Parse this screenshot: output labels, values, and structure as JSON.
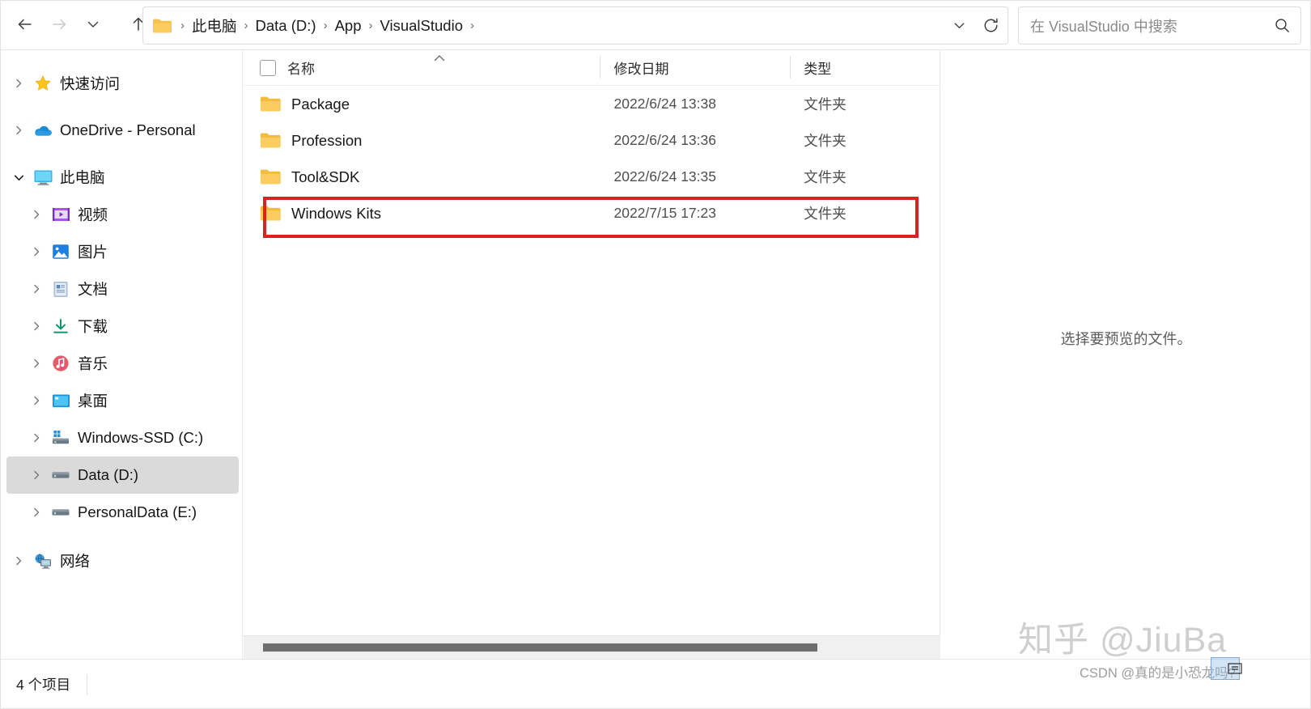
{
  "window": {
    "title": "VisualStudio"
  },
  "toolbar": {
    "back_label": "back-arrow",
    "forward_label": "forward-arrow",
    "recent_label": "recent-locations-chevron",
    "up_label": "up-arrow"
  },
  "address": {
    "folder_icon": "folder-icon",
    "crumbs": [
      "此电脑",
      "Data (D:)",
      "App",
      "VisualStudio"
    ],
    "separator": "›",
    "trailing_separator": "›",
    "dropdown_icon": "chevron-down-icon",
    "refresh_icon": "refresh-icon"
  },
  "search": {
    "placeholder": "在 VisualStudio 中搜索",
    "icon": "search-icon"
  },
  "sidebar": {
    "items": [
      {
        "label": "快速访问",
        "icon": "star-icon",
        "indent": 1,
        "expanded": false,
        "selected": false
      },
      {
        "label": "OneDrive - Personal",
        "icon": "cloud-icon",
        "indent": 1,
        "expanded": false,
        "selected": false
      },
      {
        "label": "此电脑",
        "icon": "monitor-icon",
        "indent": 1,
        "expanded": true,
        "selected": false
      },
      {
        "label": "视频",
        "icon": "videos-icon",
        "indent": 2,
        "expanded": false,
        "selected": false
      },
      {
        "label": "图片",
        "icon": "pictures-icon",
        "indent": 2,
        "expanded": false,
        "selected": false
      },
      {
        "label": "文档",
        "icon": "documents-icon",
        "indent": 2,
        "expanded": false,
        "selected": false
      },
      {
        "label": "下载",
        "icon": "downloads-icon",
        "indent": 2,
        "expanded": false,
        "selected": false
      },
      {
        "label": "音乐",
        "icon": "music-icon",
        "indent": 2,
        "expanded": false,
        "selected": false
      },
      {
        "label": "桌面",
        "icon": "desktop-icon",
        "indent": 2,
        "expanded": false,
        "selected": false
      },
      {
        "label": "Windows-SSD (C:)",
        "icon": "system-drive-icon",
        "indent": 2,
        "expanded": false,
        "selected": false
      },
      {
        "label": "Data (D:)",
        "icon": "drive-icon",
        "indent": 2,
        "expanded": false,
        "selected": true
      },
      {
        "label": "PersonalData (E:)",
        "icon": "drive-icon",
        "indent": 2,
        "expanded": false,
        "selected": false
      },
      {
        "label": "网络",
        "icon": "network-icon",
        "indent": 1,
        "expanded": false,
        "selected": false
      }
    ]
  },
  "filelist": {
    "columns": [
      {
        "key": "name",
        "label": "名称",
        "sorted": "asc"
      },
      {
        "key": "date",
        "label": "修改日期",
        "sorted": ""
      },
      {
        "key": "type",
        "label": "类型",
        "sorted": ""
      }
    ],
    "sort_caret": "sort-ascending-caret",
    "rows": [
      {
        "name": "Package",
        "date": "2022/6/24 13:38",
        "type": "文件夹",
        "icon": "folder-icon",
        "highlighted": false
      },
      {
        "name": "Profession",
        "date": "2022/6/24 13:36",
        "type": "文件夹",
        "icon": "folder-icon",
        "highlighted": false
      },
      {
        "name": "Tool&SDK",
        "date": "2022/6/24 13:35",
        "type": "文件夹",
        "icon": "folder-icon",
        "highlighted": false
      },
      {
        "name": "Windows Kits",
        "date": "2022/7/15 17:23",
        "type": "文件夹",
        "icon": "folder-icon",
        "highlighted": true
      }
    ],
    "annotation_color": "#e02020"
  },
  "preview": {
    "message": "选择要预览的文件。"
  },
  "statusbar": {
    "item_count": "4 个项目"
  },
  "watermarks": {
    "zhihu": "知乎 @JiuBa",
    "csdn": "CSDN @真的是小恐龙吗?"
  },
  "colors": {
    "accent": "#e02020",
    "folder_yellow": "#fcc419",
    "selection_gray": "#dadada",
    "scrollbar_thumb": "#6e6e6e"
  }
}
